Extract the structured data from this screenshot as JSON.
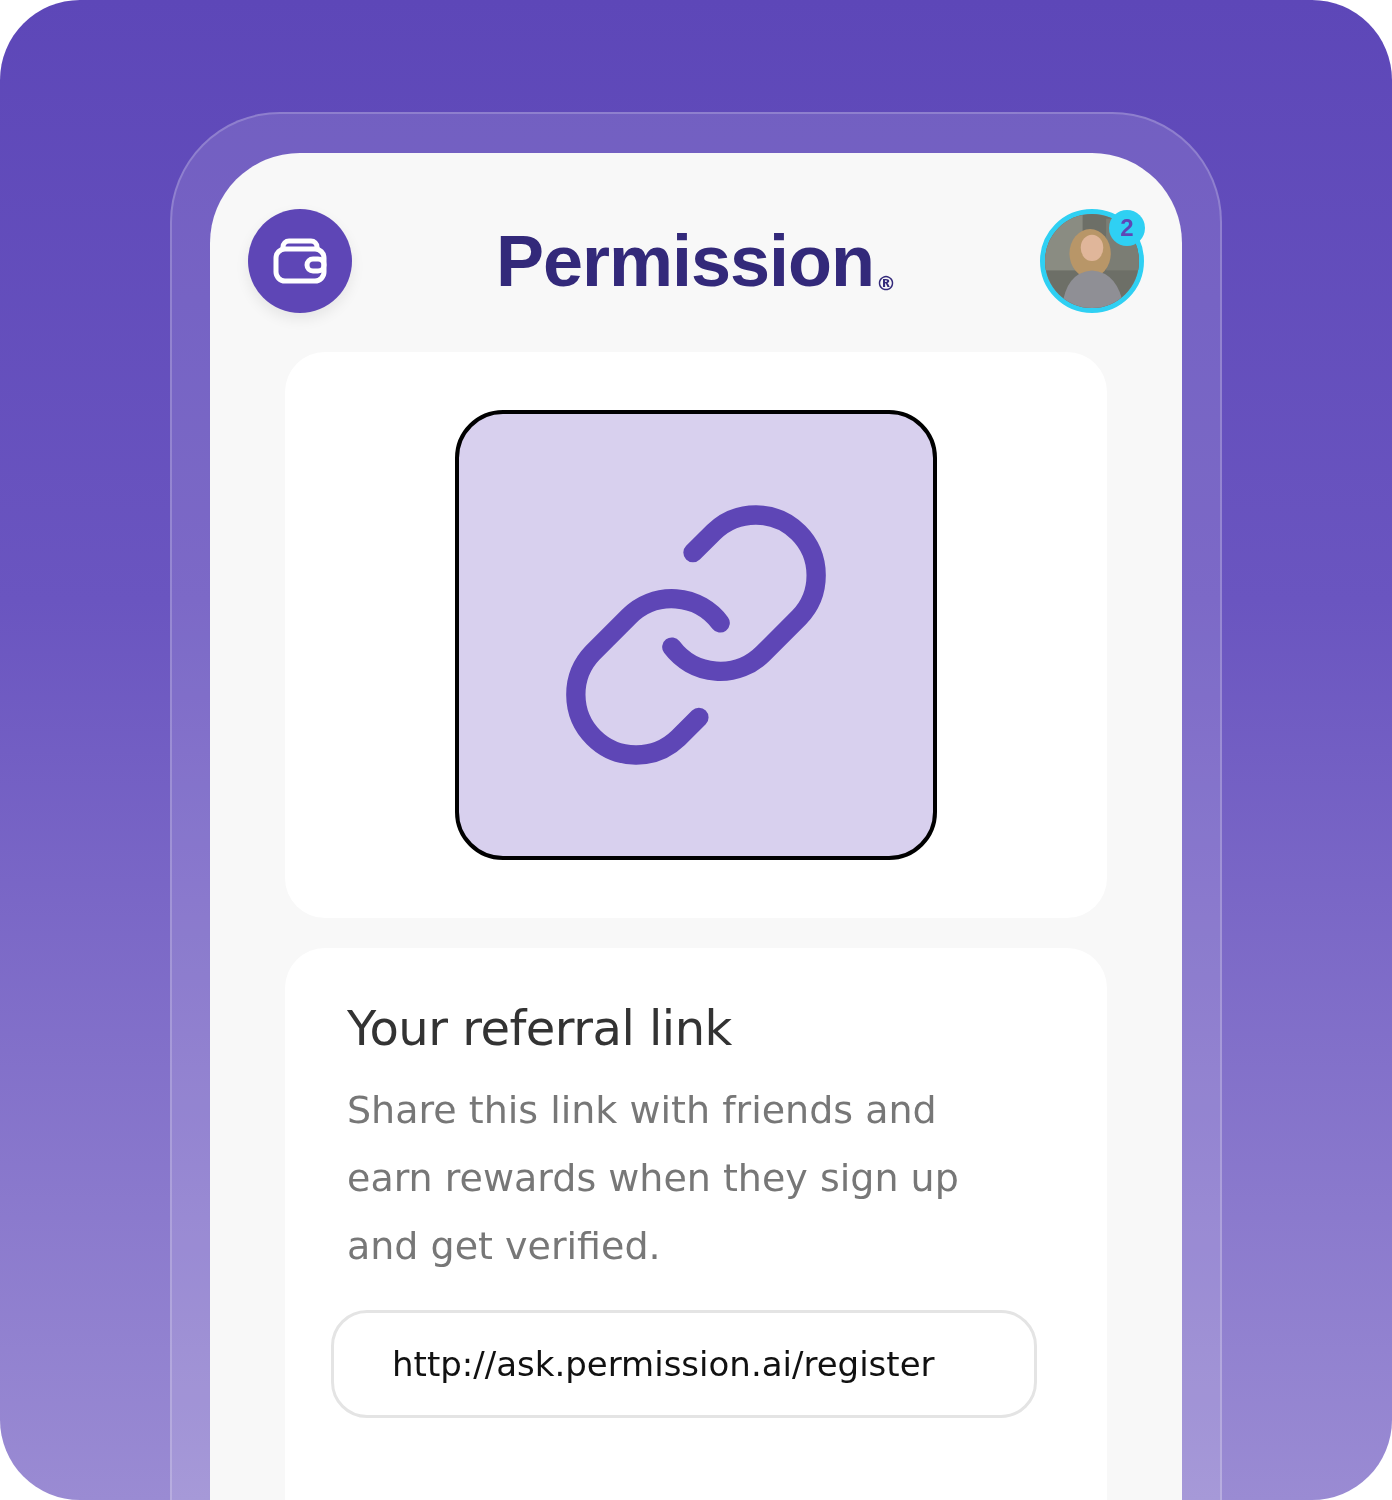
{
  "header": {
    "logo": {
      "text": "Permission",
      "mark": "®"
    },
    "avatar": {
      "kind": "picture",
      "badge": "2"
    }
  },
  "hero": {
    "kind": "link"
  },
  "referral": {
    "title": "Your referral link",
    "description": "Share this link with friends and earn rewards when they sign up and get verified.",
    "link": "http://ask.permission.ai/register"
  }
}
